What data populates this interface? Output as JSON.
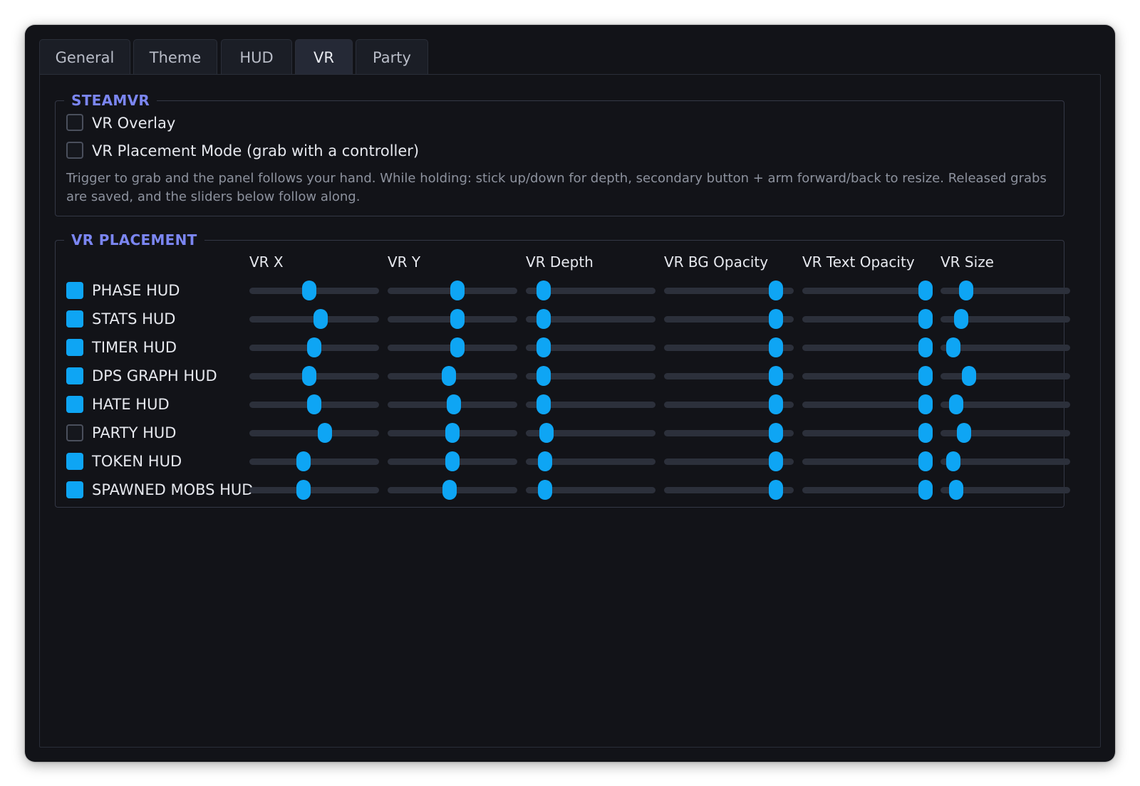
{
  "tabs": [
    {
      "label": "General"
    },
    {
      "label": "Theme"
    },
    {
      "label": "HUD"
    },
    {
      "label": "VR",
      "active": true
    },
    {
      "label": "Party"
    }
  ],
  "steamvr": {
    "title": "STEAMVR",
    "vr_overlay": {
      "label": "VR Overlay",
      "checked": false
    },
    "placement_mode": {
      "label": "VR Placement Mode (grab with a controller)",
      "checked": false
    },
    "hint": "Trigger to grab and the panel follows your hand. While holding: stick up/down for depth, secondary button + arm forward/back to resize. Released grabs are saved, and the sliders below follow along."
  },
  "placement": {
    "title": "VR PLACEMENT",
    "columns": [
      "VR X",
      "VR Y",
      "VR Depth",
      "VR BG Opacity",
      "VR Text Opacity",
      "VR Size"
    ],
    "rows": [
      {
        "label": "PHASE HUD",
        "checked": true,
        "values": [
          0.46,
          0.54,
          0.14,
          0.86,
          0.95,
          0.2
        ]
      },
      {
        "label": "STATS HUD",
        "checked": true,
        "values": [
          0.55,
          0.54,
          0.14,
          0.86,
          0.95,
          0.16
        ]
      },
      {
        "label": "TIMER HUD",
        "checked": true,
        "values": [
          0.5,
          0.54,
          0.14,
          0.86,
          0.95,
          0.1
        ]
      },
      {
        "label": "DPS GRAPH HUD",
        "checked": true,
        "values": [
          0.46,
          0.47,
          0.14,
          0.86,
          0.95,
          0.22
        ]
      },
      {
        "label": "HATE HUD",
        "checked": true,
        "values": [
          0.5,
          0.51,
          0.14,
          0.86,
          0.95,
          0.12
        ]
      },
      {
        "label": "PARTY HUD",
        "checked": false,
        "values": [
          0.58,
          0.5,
          0.16,
          0.86,
          0.95,
          0.18
        ]
      },
      {
        "label": "TOKEN HUD",
        "checked": true,
        "values": [
          0.42,
          0.5,
          0.15,
          0.86,
          0.95,
          0.1
        ]
      },
      {
        "label": "SPAWNED MOBS HUD",
        "checked": true,
        "values": [
          0.42,
          0.48,
          0.15,
          0.86,
          0.95,
          0.12
        ]
      }
    ]
  },
  "colors": {
    "accent": "#0ea5f4",
    "group_title": "#7b86f2",
    "background": "#121318"
  }
}
